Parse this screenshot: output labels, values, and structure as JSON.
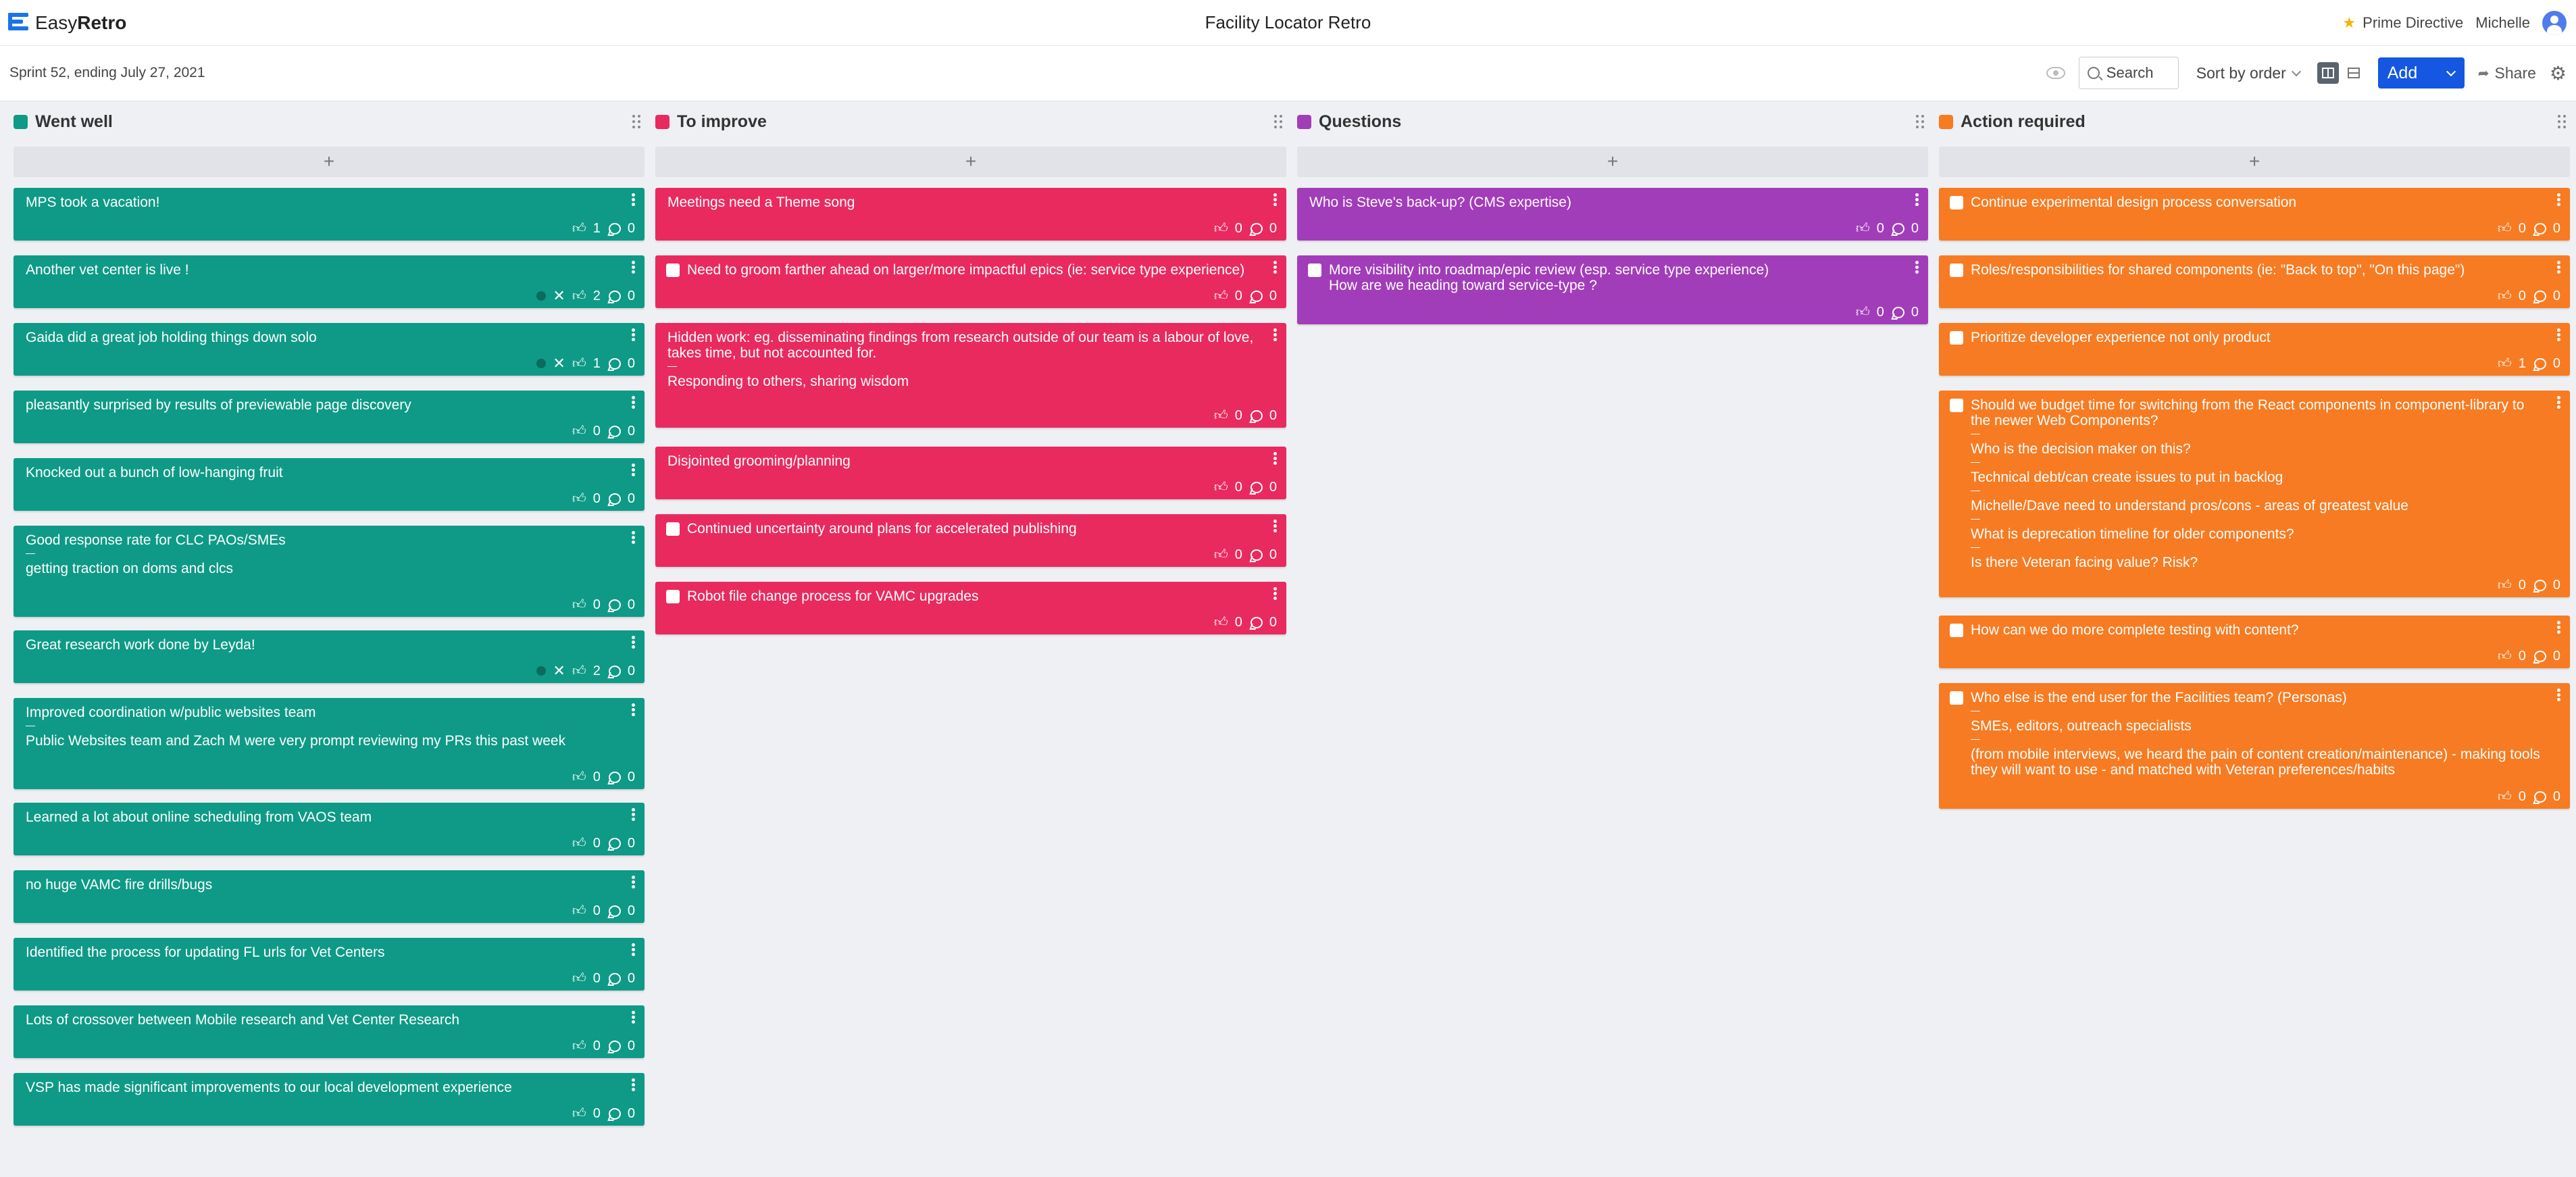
{
  "app": {
    "logo_text_light": "Easy",
    "logo_text_bold": "Retro",
    "board_title": "Facility Locator Retro",
    "plan_label": "Prime Directive",
    "user_name": "Michelle"
  },
  "toolbar": {
    "sprint_label": "Sprint 52, ending July 27, 2021",
    "search_label": "Search",
    "sort_label": "Sort by order",
    "add_label": "Add",
    "share_label": "Share"
  },
  "colors": {
    "went_well": "#0e9a87",
    "to_improve": "#e92a5f",
    "questions": "#a23db9",
    "action_required": "#f77b22",
    "accent": "#1557e0"
  },
  "columns": [
    {
      "title": "Went well",
      "add_symbol": "+",
      "cards": [
        {
          "paragraphs": [
            "MPS took a vacation!"
          ],
          "likes": "1",
          "comments": "0",
          "checkbox": false,
          "voted": false
        },
        {
          "paragraphs": [
            "Another vet center is live !"
          ],
          "likes": "2",
          "comments": "0",
          "checkbox": false,
          "voted": true
        },
        {
          "paragraphs": [
            "Gaida did a great job holding things down solo"
          ],
          "likes": "1",
          "comments": "0",
          "checkbox": false,
          "voted": true
        },
        {
          "paragraphs": [
            "pleasantly surprised by results of previewable page discovery"
          ],
          "likes": "0",
          "comments": "0",
          "checkbox": false,
          "voted": false
        },
        {
          "paragraphs": [
            "Knocked out a bunch of low-hanging fruit"
          ],
          "likes": "0",
          "comments": "0",
          "checkbox": false,
          "voted": false
        },
        {
          "paragraphs": [
            "Good response rate for CLC PAOs/SMEs",
            "getting traction on doms and clcs"
          ],
          "likes": "0",
          "comments": "0",
          "checkbox": false,
          "voted": false
        },
        {
          "paragraphs": [
            "Great research work done by Leyda!"
          ],
          "likes": "2",
          "comments": "0",
          "checkbox": false,
          "voted": true
        },
        {
          "paragraphs": [
            "Improved coordination w/public websites team",
            "Public Websites team and Zach M were very prompt reviewing my PRs this past week"
          ],
          "likes": "0",
          "comments": "0",
          "checkbox": false,
          "voted": false
        },
        {
          "paragraphs": [
            "Learned a lot about online scheduling from VAOS team"
          ],
          "likes": "0",
          "comments": "0",
          "checkbox": false,
          "voted": false
        },
        {
          "paragraphs": [
            "no huge VAMC fire drills/bugs"
          ],
          "likes": "0",
          "comments": "0",
          "checkbox": false,
          "voted": false
        },
        {
          "paragraphs": [
            "Identified the process for updating FL urls for Vet Centers"
          ],
          "likes": "0",
          "comments": "0",
          "checkbox": false,
          "voted": false
        },
        {
          "paragraphs": [
            "Lots of crossover between Mobile research and Vet Center Research"
          ],
          "likes": "0",
          "comments": "0",
          "checkbox": false,
          "voted": false
        },
        {
          "paragraphs": [
            "VSP has made significant improvements to our local development experience"
          ],
          "likes": "0",
          "comments": "0",
          "checkbox": false,
          "voted": false
        }
      ]
    },
    {
      "title": "To improve",
      "add_symbol": "+",
      "cards": [
        {
          "paragraphs": [
            "Meetings need a Theme song"
          ],
          "likes": "0",
          "comments": "0",
          "checkbox": false,
          "voted": false
        },
        {
          "paragraphs": [
            "Need to groom farther ahead on larger/more impactful epics (ie: service type experience)"
          ],
          "likes": "0",
          "comments": "0",
          "checkbox": true,
          "voted": false
        },
        {
          "paragraphs": [
            "Hidden work: eg. disseminating findings from research outside of our team is a labour of love, takes time, but not accounted for.",
            "Responding to others, sharing wisdom"
          ],
          "likes": "0",
          "comments": "0",
          "checkbox": false,
          "voted": false
        },
        {
          "paragraphs": [
            "Disjointed grooming/planning"
          ],
          "likes": "0",
          "comments": "0",
          "checkbox": false,
          "voted": false
        },
        {
          "paragraphs": [
            "Continued uncertainty around plans for accelerated publishing"
          ],
          "likes": "0",
          "comments": "0",
          "checkbox": true,
          "voted": false
        },
        {
          "paragraphs": [
            "Robot file change process for VAMC upgrades"
          ],
          "likes": "0",
          "comments": "0",
          "checkbox": true,
          "voted": false
        }
      ]
    },
    {
      "title": "Questions",
      "add_symbol": "+",
      "cards": [
        {
          "paragraphs": [
            "Who is Steve's back-up? (CMS expertise)"
          ],
          "likes": "0",
          "comments": "0",
          "checkbox": false,
          "voted": false
        },
        {
          "paragraphs": [
            "More visibility into roadmap/epic review (esp. service type experience)\nHow are we heading toward service-type ?"
          ],
          "likes": "0",
          "comments": "0",
          "checkbox": true,
          "voted": false
        }
      ]
    },
    {
      "title": "Action required",
      "add_symbol": "+",
      "cards": [
        {
          "paragraphs": [
            "Continue experimental design process conversation"
          ],
          "likes": "0",
          "comments": "0",
          "checkbox": true,
          "voted": false
        },
        {
          "paragraphs": [
            "Roles/responsibilities for shared components (ie: \"Back to top\", \"On this page\")"
          ],
          "likes": "0",
          "comments": "0",
          "checkbox": true,
          "voted": false
        },
        {
          "paragraphs": [
            "Prioritize developer experience not only product"
          ],
          "likes": "1",
          "comments": "0",
          "checkbox": true,
          "voted": false
        },
        {
          "paragraphs": [
            "Should we budget time for switching from the React components in component-library to the newer Web Components?",
            "Who is the decision maker on this?",
            "Technical debt/can create issues to put in backlog",
            "Michelle/Dave need to understand pros/cons - areas of greatest value",
            "What is deprecation timeline for older components?",
            "Is there Veteran facing value? Risk?"
          ],
          "likes": "0",
          "comments": "0",
          "checkbox": true,
          "voted": false
        },
        {
          "paragraphs": [
            "How can we do more complete testing with content?"
          ],
          "likes": "0",
          "comments": "0",
          "checkbox": true,
          "voted": false
        },
        {
          "paragraphs": [
            "Who else is the end user for the Facilities team? (Personas)",
            "SMEs, editors, outreach specialists",
            "(from mobile interviews, we heard the pain of content creation/maintenance) - making tools they will want to use - and matched with Veteran preferences/habits"
          ],
          "likes": "0",
          "comments": "0",
          "checkbox": true,
          "voted": false
        }
      ]
    }
  ]
}
